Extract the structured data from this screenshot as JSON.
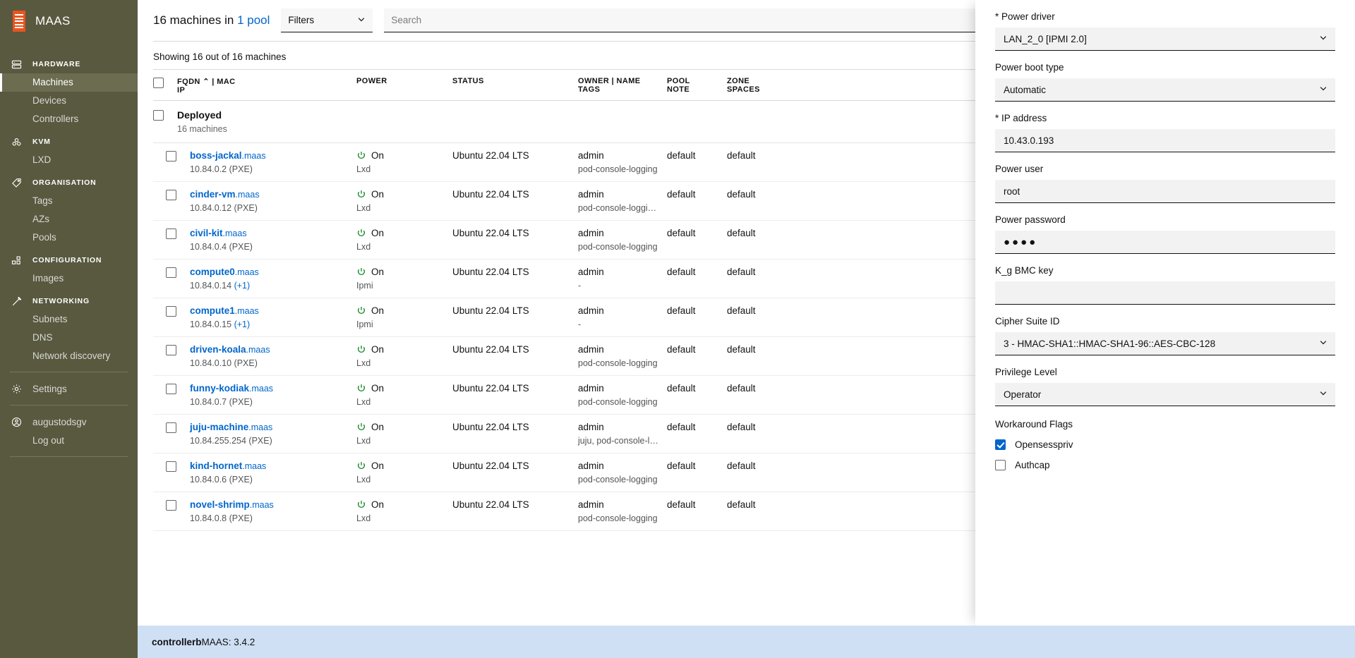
{
  "brand": {
    "name": "MAAS",
    "logo_icon": "maas-logo-icon"
  },
  "sidebar": {
    "groups": [
      {
        "section": "HARDWARE",
        "section_icon": "server-icon",
        "items": [
          {
            "label": "Machines",
            "active": true
          },
          {
            "label": "Devices",
            "active": false
          },
          {
            "label": "Controllers",
            "active": false
          }
        ]
      },
      {
        "section": "KVM",
        "section_icon": "kvm-icon",
        "items": [
          {
            "label": "LXD",
            "active": false
          }
        ]
      },
      {
        "section": "ORGANISATION",
        "section_icon": "tag-icon",
        "items": [
          {
            "label": "Tags",
            "active": false
          },
          {
            "label": "AZs",
            "active": false
          },
          {
            "label": "Pools",
            "active": false
          }
        ]
      },
      {
        "section": "CONFIGURATION",
        "section_icon": "images-icon",
        "items": [
          {
            "label": "Images",
            "active": false
          }
        ]
      },
      {
        "section": "NETWORKING",
        "section_icon": "network-icon",
        "items": [
          {
            "label": "Subnets",
            "active": false
          },
          {
            "label": "DNS",
            "active": false
          },
          {
            "label": "Network discovery",
            "active": false
          }
        ]
      }
    ],
    "settings": {
      "label": "Settings",
      "icon": "gear-icon"
    },
    "account": {
      "user": "augustodsgv",
      "icon": "user-icon",
      "logout": "Log out"
    }
  },
  "toolbar": {
    "title_prefix": "16 machines in ",
    "pool_link": "1 pool",
    "filters_label": "Filters",
    "search_placeholder": "Search",
    "search_value": "",
    "chevron_icon": "chevron-down-icon",
    "clear_icon": "clear-search-icon"
  },
  "table": {
    "showing": "Showing 16 out of 16 machines",
    "headers": {
      "fqdn": "FQDN  ⌃ | MAC",
      "fqdn_sub": "IP",
      "power": "POWER",
      "status": "STATUS",
      "owner": "OWNER | NAME",
      "owner_sub": "TAGS",
      "pool": "POOL",
      "pool_sub": "NOTE",
      "zone": "ZONE",
      "zone_sub": "SPACES"
    },
    "group": {
      "name": "Deployed",
      "count": "16 machines"
    },
    "rows": [
      {
        "name": "boss-jackal",
        "domain": ".maas",
        "ip": "10.84.0.2 (PXE)",
        "extra": "",
        "power": "On",
        "power_type": "Lxd",
        "status": "Ubuntu 22.04 LTS",
        "owner": "admin",
        "tags": "pod-console-logging",
        "pool": "default",
        "zone": "default"
      },
      {
        "name": "cinder-vm",
        "domain": ".maas",
        "ip": "10.84.0.12 (PXE)",
        "extra": "",
        "power": "On",
        "power_type": "Lxd",
        "status": "Ubuntu 22.04 LTS",
        "owner": "admin",
        "tags": "pod-console-loggi…",
        "pool": "default",
        "zone": "default"
      },
      {
        "name": "civil-kit",
        "domain": ".maas",
        "ip": "10.84.0.4 (PXE)",
        "extra": "",
        "power": "On",
        "power_type": "Lxd",
        "status": "Ubuntu 22.04 LTS",
        "owner": "admin",
        "tags": "pod-console-logging",
        "pool": "default",
        "zone": "default"
      },
      {
        "name": "compute0",
        "domain": ".maas",
        "ip": "10.84.0.14 ",
        "extra": "(+1)",
        "power": "On",
        "power_type": "Ipmi",
        "status": "Ubuntu 22.04 LTS",
        "owner": "admin",
        "tags": "-",
        "pool": "default",
        "zone": "default"
      },
      {
        "name": "compute1",
        "domain": ".maas",
        "ip": "10.84.0.15 ",
        "extra": "(+1)",
        "power": "On",
        "power_type": "Ipmi",
        "status": "Ubuntu 22.04 LTS",
        "owner": "admin",
        "tags": "-",
        "pool": "default",
        "zone": "default"
      },
      {
        "name": "driven-koala",
        "domain": ".maas",
        "ip": "10.84.0.10 (PXE)",
        "extra": "",
        "power": "On",
        "power_type": "Lxd",
        "status": "Ubuntu 22.04 LTS",
        "owner": "admin",
        "tags": "pod-console-logging",
        "pool": "default",
        "zone": "default"
      },
      {
        "name": "funny-kodiak",
        "domain": ".maas",
        "ip": "10.84.0.7 (PXE)",
        "extra": "",
        "power": "On",
        "power_type": "Lxd",
        "status": "Ubuntu 22.04 LTS",
        "owner": "admin",
        "tags": "pod-console-logging",
        "pool": "default",
        "zone": "default"
      },
      {
        "name": "juju-machine",
        "domain": ".maas",
        "ip": "10.84.255.254 (PXE)",
        "extra": "",
        "power": "On",
        "power_type": "Lxd",
        "status": "Ubuntu 22.04 LTS",
        "owner": "admin",
        "tags": "juju, pod-console-l…",
        "pool": "default",
        "zone": "default"
      },
      {
        "name": "kind-hornet",
        "domain": ".maas",
        "ip": "10.84.0.6 (PXE)",
        "extra": "",
        "power": "On",
        "power_type": "Lxd",
        "status": "Ubuntu 22.04 LTS",
        "owner": "admin",
        "tags": "pod-console-logging",
        "pool": "default",
        "zone": "default"
      },
      {
        "name": "novel-shrimp",
        "domain": ".maas",
        "ip": "10.84.0.8 (PXE)",
        "extra": "",
        "power": "On",
        "power_type": "Lxd",
        "status": "Ubuntu 22.04 LTS",
        "owner": "admin",
        "tags": "pod-console-logging",
        "pool": "default",
        "zone": "default"
      }
    ]
  },
  "panel": {
    "fields": [
      {
        "key": "power_driver",
        "label": "* Power driver",
        "value": "LAN_2_0 [IPMI 2.0]",
        "kind": "select"
      },
      {
        "key": "power_boot_type",
        "label": "Power boot type",
        "value": "Automatic",
        "kind": "select"
      },
      {
        "key": "ip_address",
        "label": "* IP address",
        "value": "10.43.0.193",
        "kind": "text"
      },
      {
        "key": "power_user",
        "label": "Power user",
        "value": "root",
        "kind": "text"
      },
      {
        "key": "power_password",
        "label": "Power password",
        "value": "●●●●",
        "kind": "password"
      },
      {
        "key": "kg_bmc_key",
        "label": "K_g BMC key",
        "value": "",
        "kind": "text"
      },
      {
        "key": "cipher_suite_id",
        "label": "Cipher Suite ID",
        "value": "3 - HMAC-SHA1::HMAC-SHA1-96::AES-CBC-128",
        "kind": "select"
      },
      {
        "key": "privilege_level",
        "label": "Privilege Level",
        "value": "Operator",
        "kind": "select"
      }
    ],
    "workaround_flags_title": "Workaround Flags",
    "checkboxes": [
      {
        "label": "Opensesspriv",
        "checked": true
      },
      {
        "label": "Authcap",
        "checked": false
      }
    ],
    "chevron_icon": "chevron-down-icon"
  },
  "statusbar": {
    "host": "controllerb",
    "text": " MAAS: 3.4.2"
  },
  "colors": {
    "sidebar_bg": "#58593f",
    "sidebar_active": "#6b6c50",
    "brand_orange": "#e95420",
    "link_blue": "#0066cc",
    "power_on_green": "#0e8420",
    "statusbar_bg": "#cfe0f5"
  }
}
